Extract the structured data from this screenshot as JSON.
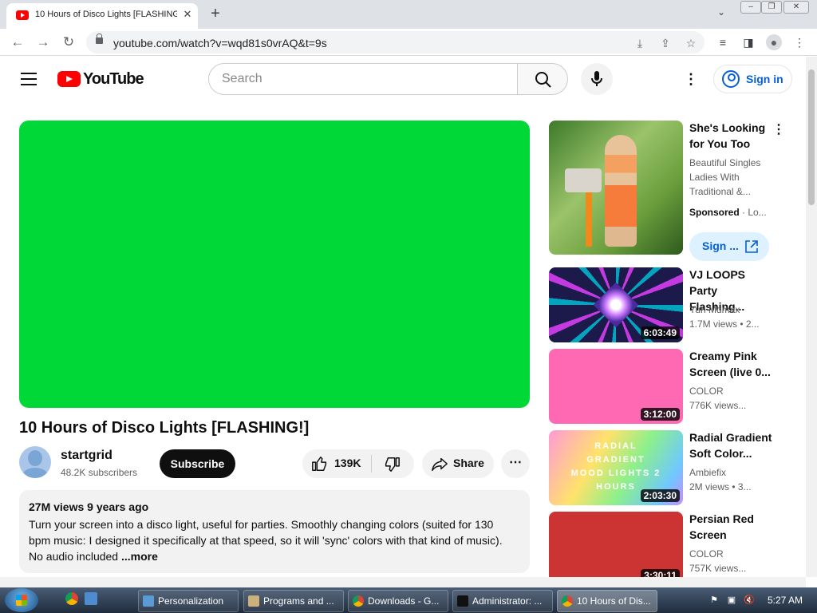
{
  "browser": {
    "tab_title": "10 Hours of Disco Lights [FLASHING!]",
    "url": "youtube.com/watch?v=wqd81s0vrAQ&t=9s"
  },
  "youtube": {
    "logo_text": "YouTube",
    "search_placeholder": "Search",
    "sign_in_label": "Sign in"
  },
  "video": {
    "player_color": "#00d838",
    "title": "10 Hours of Disco Lights [FLASHING!]",
    "channel": "startgrid",
    "subscribers": "48.2K subscribers",
    "subscribe_label": "Subscribe",
    "likes": "139K",
    "share_label": "Share",
    "views_and_age": "27M views  9 years ago",
    "description": "Turn your screen into a disco light, useful for parties. Smoothly changing colors (suited for 130 bpm music: I designed it specifically at that speed, so it will 'sync' colors with that kind of music). No audio included",
    "more_label": "...more"
  },
  "sidebar": {
    "ad": {
      "title": "She's Looking for You Too",
      "description": "Beautiful Singles Ladies With Traditional &...",
      "sponsored_label": "Sponsored",
      "advertiser": "Lo...",
      "cta_label": "Sign ..."
    },
    "videos": [
      {
        "title": "VJ LOOPS Party Flashing...",
        "channel": "Yuri Mdmax",
        "meta": "1.7M views  • 2...",
        "duration": "6:03:49",
        "thumb_color": "#1c1a4a"
      },
      {
        "title": "Creamy Pink Screen (live 0...",
        "channel": "COLOR",
        "meta": "776K views...",
        "duration": "3:12:00",
        "thumb_color": "#ff69b4"
      },
      {
        "title": "Radial Gradient Soft Color...",
        "channel": "Ambiefix",
        "meta": "2M views  • 3...",
        "duration": "2:03:30",
        "thumb_text": "RADIAL GRADIENT MOOD LIGHTS 2 HOURS"
      },
      {
        "title": "Persian Red Screen",
        "channel": "COLOR",
        "meta": "757K views...",
        "duration": "3:30:11",
        "thumb_color": "#cc3333"
      }
    ]
  },
  "taskbar": {
    "items": [
      "Personalization",
      "Programs and ...",
      "Downloads - G...",
      "Administrator: ...",
      "10 Hours of Dis..."
    ],
    "clock": "5:27 AM"
  }
}
